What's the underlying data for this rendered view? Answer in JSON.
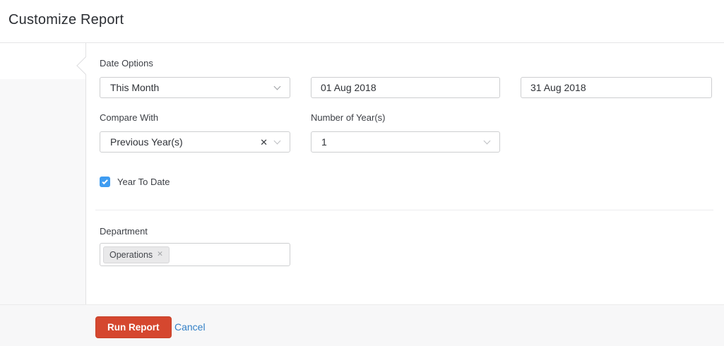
{
  "header": {
    "title": "Customize Report"
  },
  "form": {
    "date_options": {
      "label": "Date Options",
      "value": "This Month"
    },
    "from_date": {
      "value": "01 Aug 2018"
    },
    "to_date": {
      "value": "31 Aug 2018"
    },
    "compare_with": {
      "label": "Compare With",
      "value": "Previous Year(s)",
      "clear_icon": "✕"
    },
    "number_of_years": {
      "label": "Number of Year(s)",
      "value": "1"
    },
    "year_to_date": {
      "label": "Year To Date",
      "checked": true
    },
    "department": {
      "label": "Department",
      "tags": [
        {
          "label": "Operations",
          "remove_icon": "✕"
        }
      ]
    }
  },
  "footer": {
    "run_report_label": "Run Report",
    "cancel_label": "Cancel"
  },
  "colors": {
    "accent_red": "#d5472f",
    "link_blue": "#3380c7",
    "checkbox_blue": "#3f9cf1"
  }
}
